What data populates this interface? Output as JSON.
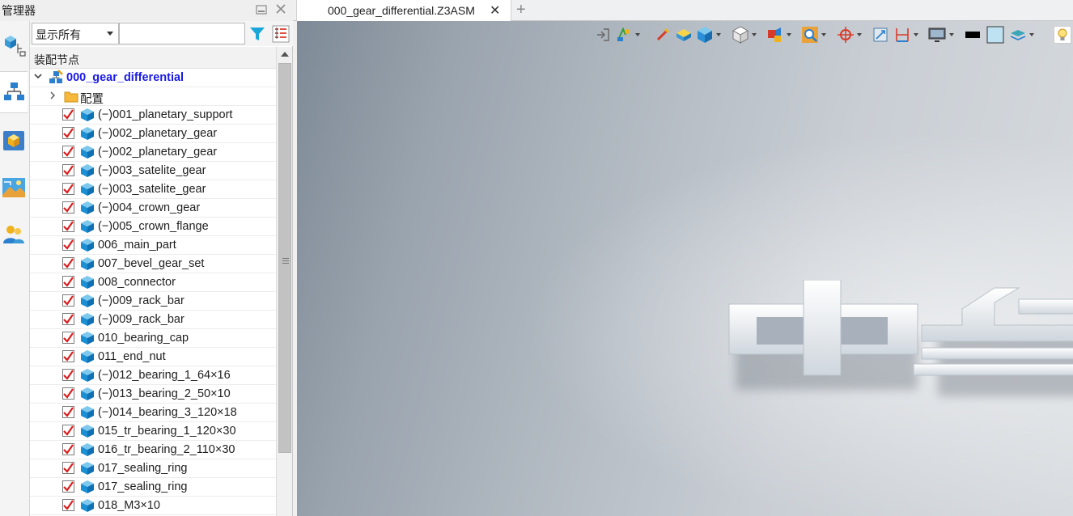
{
  "manager": {
    "title": "管理器",
    "filter_selected": "显示所有",
    "filter_value": "",
    "column_header": "装配节点",
    "root_label": "000_gear_differential",
    "config_label": "配置",
    "items": [
      {
        "label": "(−)001_planetary_support"
      },
      {
        "label": "(−)002_planetary_gear"
      },
      {
        "label": "(−)002_planetary_gear"
      },
      {
        "label": "(−)003_satelite_gear"
      },
      {
        "label": "(−)003_satelite_gear"
      },
      {
        "label": "(−)004_crown_gear"
      },
      {
        "label": "(−)005_crown_flange"
      },
      {
        "label": "006_main_part"
      },
      {
        "label": "007_bevel_gear_set"
      },
      {
        "label": "008_connector"
      },
      {
        "label": "(−)009_rack_bar"
      },
      {
        "label": "(−)009_rack_bar"
      },
      {
        "label": "010_bearing_cap"
      },
      {
        "label": "011_end_nut"
      },
      {
        "label": "(−)012_bearing_1_64×16"
      },
      {
        "label": "(−)013_bearing_2_50×10"
      },
      {
        "label": "(−)014_bearing_3_120×18"
      },
      {
        "label": "015_tr_bearing_1_120×30"
      },
      {
        "label": "016_tr_bearing_2_110×30"
      },
      {
        "label": "017_sealing_ring"
      },
      {
        "label": "017_sealing_ring"
      },
      {
        "label": "018_M3×10"
      }
    ]
  },
  "tabs": [
    {
      "label": "000_gear_differential.Z3ASM",
      "close": "✕"
    }
  ],
  "tab_add": "+",
  "colors": {
    "root_text": "#1a1ae6",
    "check_red": "#d81e1e",
    "cube_blue": "#1a8fd4"
  }
}
